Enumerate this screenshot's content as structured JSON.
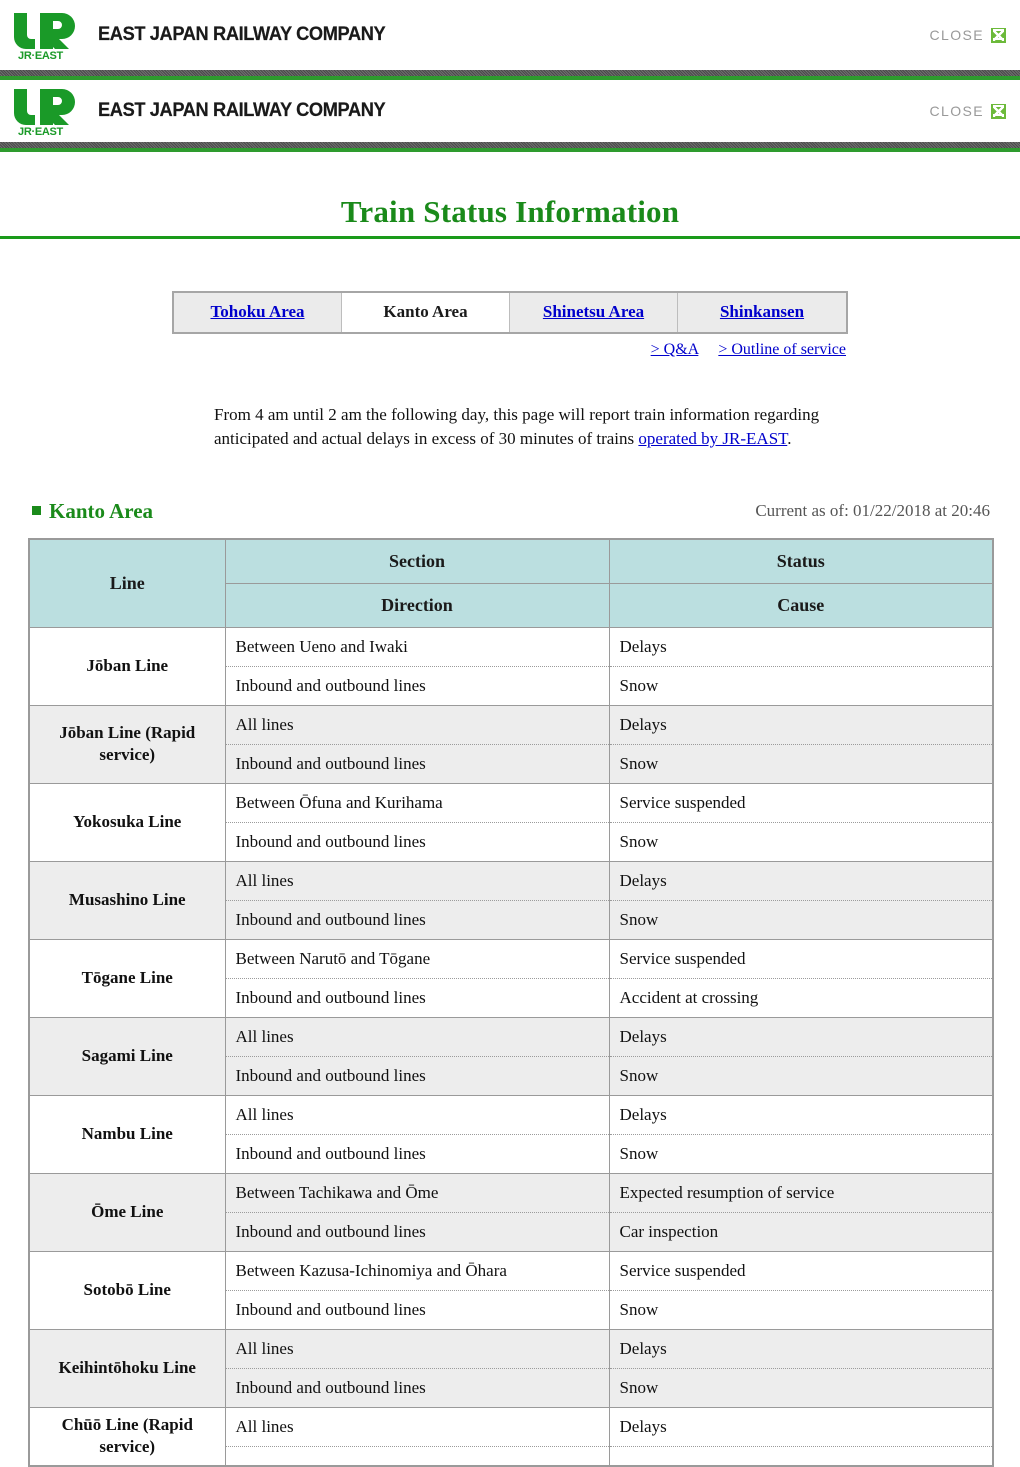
{
  "branding": {
    "company_name": "EAST JAPAN RAILWAY COMPANY",
    "logo_text": "JR",
    "logo_sub_text": "JR-EAST",
    "close_label": "CLOSE",
    "close_icon": "close-x-icon",
    "accent_green": "#1a8a1a",
    "rule_green": "#2e9b2e",
    "close_icon_green": "#6cba3a"
  },
  "page": {
    "title": "Train Status Information"
  },
  "tabs": [
    {
      "label": "Tohoku Area",
      "active": false
    },
    {
      "label": "Kanto Area",
      "active": true
    },
    {
      "label": "Shinetsu Area",
      "active": false
    },
    {
      "label": "Shinkansen",
      "active": false
    }
  ],
  "sublinks": [
    {
      "label": "> Q&A"
    },
    {
      "label": "> Outline of service"
    }
  ],
  "intro": {
    "before_link": "From 4 am until 2 am the following day, this page will report train information regarding anticipated and actual delays in excess of 30 minutes of trains ",
    "link_text": "operated by JR-EAST",
    "after_link": "."
  },
  "area": {
    "bullet": "square-bullet-icon",
    "heading": "Kanto Area",
    "current_as_of": "Current as of: 01/22/2018 at 20:46"
  },
  "table": {
    "headers": {
      "line": "Line",
      "section": "Section",
      "status": "Status",
      "direction": "Direction",
      "cause": "Cause"
    },
    "header_bg": "#bbdfe0",
    "alt_row_bg": "#ededed",
    "rows": [
      {
        "line": "Jōban Line",
        "section": "Between Ueno and Iwaki",
        "status": "Delays",
        "direction": "Inbound and outbound lines",
        "cause": "Snow",
        "shaded": false
      },
      {
        "line": "Jōban Line (Rapid service)",
        "section": "All lines",
        "status": "Delays",
        "direction": "Inbound and outbound lines",
        "cause": "Snow",
        "shaded": true
      },
      {
        "line": "Yokosuka Line",
        "section": "Between Ōfuna and Kurihama",
        "status": "Service suspended",
        "direction": "Inbound and outbound lines",
        "cause": "Snow",
        "shaded": false
      },
      {
        "line": "Musashino Line",
        "section": "All lines",
        "status": "Delays",
        "direction": "Inbound and outbound lines",
        "cause": "Snow",
        "shaded": true
      },
      {
        "line": "Tōgane Line",
        "section": "Between Narutō and Tōgane",
        "status": "Service suspended",
        "direction": "Inbound and outbound lines",
        "cause": "Accident at crossing",
        "shaded": false
      },
      {
        "line": "Sagami Line",
        "section": "All lines",
        "status": "Delays",
        "direction": "Inbound and outbound lines",
        "cause": "Snow",
        "shaded": true
      },
      {
        "line": "Nambu Line",
        "section": "All lines",
        "status": "Delays",
        "direction": "Inbound and outbound lines",
        "cause": "Snow",
        "shaded": false
      },
      {
        "line": "Ōme Line",
        "section": "Between Tachikawa and Ōme",
        "status": "Expected resumption of service",
        "direction": "Inbound and outbound lines",
        "cause": "Car inspection",
        "shaded": true
      },
      {
        "line": "Sotobō Line",
        "section": "Between Kazusa-Ichinomiya and Ōhara",
        "status": "Service suspended",
        "direction": "Inbound and outbound lines",
        "cause": "Snow",
        "shaded": false
      },
      {
        "line": "Keihintōhoku Line",
        "section": "All lines",
        "status": "Delays",
        "direction": "Inbound and outbound lines",
        "cause": "Snow",
        "shaded": true
      },
      {
        "line": "Chūō Line (Rapid service)",
        "section": "All lines",
        "status": "Delays",
        "direction": "",
        "cause": "",
        "shaded": false
      }
    ]
  }
}
